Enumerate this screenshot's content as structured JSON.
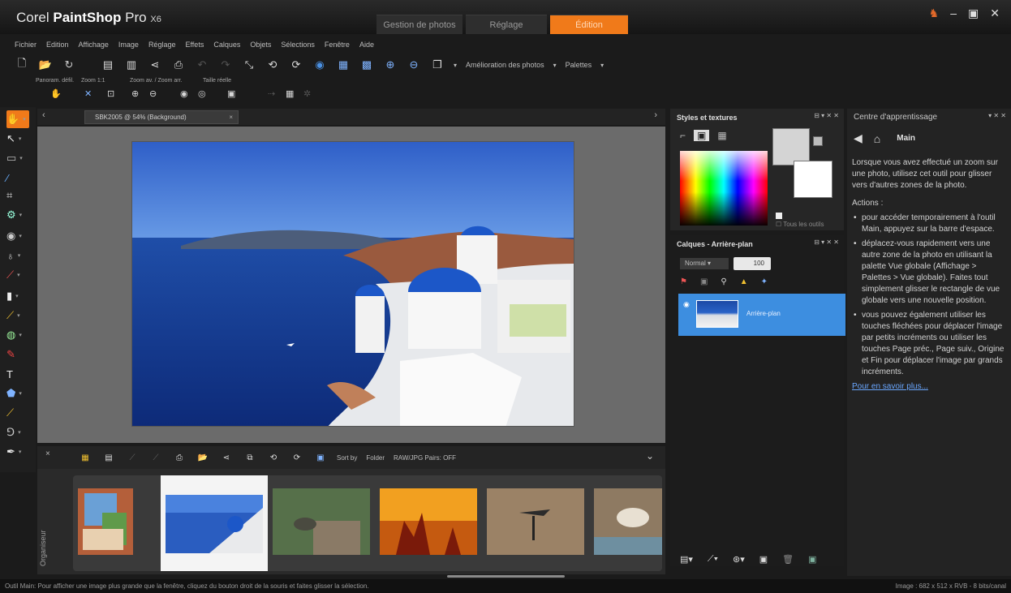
{
  "app": {
    "title_prefix": "Corel",
    "title_bold": "PaintShop",
    "title_suffix": "Pro",
    "title_version": "X6"
  },
  "mode_tabs": [
    "Gestion de photos",
    "Réglage",
    "Édition"
  ],
  "active_mode": "Édition",
  "menus": [
    "Fichier",
    "Edition",
    "Affichage",
    "Image",
    "Réglage",
    "Effets",
    "Calques",
    "Objets",
    "Sélections",
    "Fenêtre",
    "Aide"
  ],
  "toolbar": {
    "photo_enhance_label": "Amélioration des photos",
    "palettes_label": "Palettes"
  },
  "toolbar2": {
    "labels": [
      "Panoram. défil.",
      "Zoom 1:1",
      "Zoom av. / Zoom arr.",
      "Taille réelle"
    ]
  },
  "document": {
    "tab_label": "SBK2005 @ 54% (Background)"
  },
  "organizer": {
    "label": "Organiseur",
    "sort_label": "Sort by",
    "folder_label": "Folder",
    "raw_label": "RAW/JPG Pairs: OFF"
  },
  "styles_panel": {
    "title": "Styles et textures",
    "all_tools_label": "Tous les outils"
  },
  "layers_panel": {
    "title": "Calques - Arrière-plan",
    "blend_mode": "Normal",
    "opacity": "100",
    "layer_name": "Arrière-plan"
  },
  "learning_center": {
    "title": "Centre d'apprentissage",
    "tool_name": "Main",
    "intro": "Lorsque vous avez effectué un zoom sur une photo, utilisez cet outil pour glisser vers d'autres zones de la photo.",
    "actions_title": "Actions :",
    "bullets": [
      "pour accéder temporairement à l'outil Main, appuyez sur la barre d'espace.",
      "déplacez-vous rapidement vers une autre zone de la photo en utilisant la palette Vue globale (Affichage > Palettes > Vue globale). Faites tout simplement glisser le rectangle de vue globale vers une nouvelle position.",
      "vous pouvez également utiliser les touches fléchées pour déplacer l'image par petits incréments ou utiliser les touches Page préc., Page suiv., Origine et Fin pour déplacer l'image par grands incréments."
    ],
    "learn_more": "Pour en savoir plus..."
  },
  "status": {
    "left": "Outil Main: Pour afficher une image plus grande que la fenêtre, cliquez du bouton droit de la souris et faites glisser la sélection.",
    "right": "Image : 682 x 512 x RVB - 8 bits/canal"
  },
  "colors": {
    "accent": "#f07a1a",
    "layer_selected": "#3d8ee0",
    "link": "#6aa7ff"
  }
}
